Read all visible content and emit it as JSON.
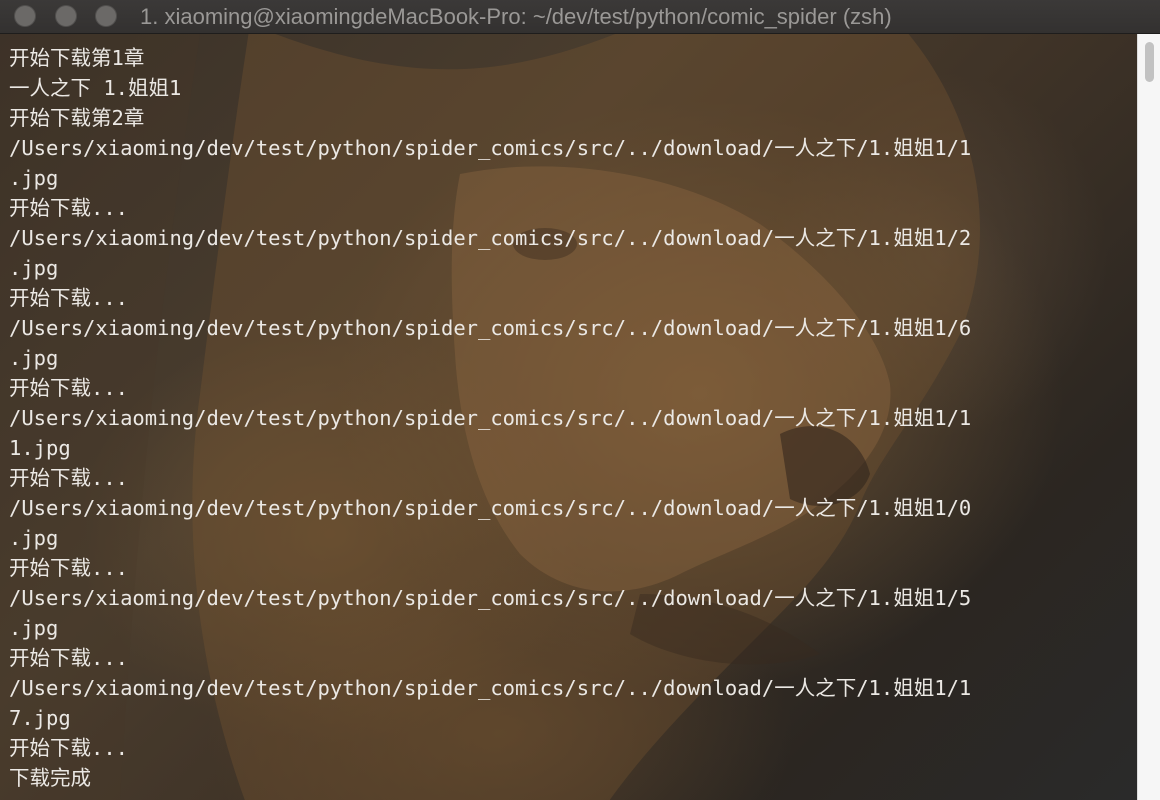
{
  "window": {
    "title": "1. xiaoming@xiaomingdeMacBook-Pro: ~/dev/test/python/comic_spider (zsh)"
  },
  "terminal": {
    "lines": [
      "开始下载第1章",
      "一人之下 1.姐姐1",
      "开始下载第2章",
      "/Users/xiaoming/dev/test/python/spider_comics/src/../download/一人之下/1.姐姐1/1",
      ".jpg",
      "开始下载...",
      "/Users/xiaoming/dev/test/python/spider_comics/src/../download/一人之下/1.姐姐1/2",
      ".jpg",
      "开始下载...",
      "/Users/xiaoming/dev/test/python/spider_comics/src/../download/一人之下/1.姐姐1/6",
      ".jpg",
      "开始下载...",
      "/Users/xiaoming/dev/test/python/spider_comics/src/../download/一人之下/1.姐姐1/1",
      "1.jpg",
      "开始下载...",
      "/Users/xiaoming/dev/test/python/spider_comics/src/../download/一人之下/1.姐姐1/0",
      ".jpg",
      "开始下载...",
      "/Users/xiaoming/dev/test/python/spider_comics/src/../download/一人之下/1.姐姐1/5",
      ".jpg",
      "开始下载...",
      "/Users/xiaoming/dev/test/python/spider_comics/src/../download/一人之下/1.姐姐1/1",
      "7.jpg",
      "开始下载...",
      "下载完成"
    ]
  },
  "colors": {
    "text": "#ebe8e4",
    "titlebar": "#383635",
    "title_text": "#9a9896",
    "traffic_light": "#6b6967"
  }
}
